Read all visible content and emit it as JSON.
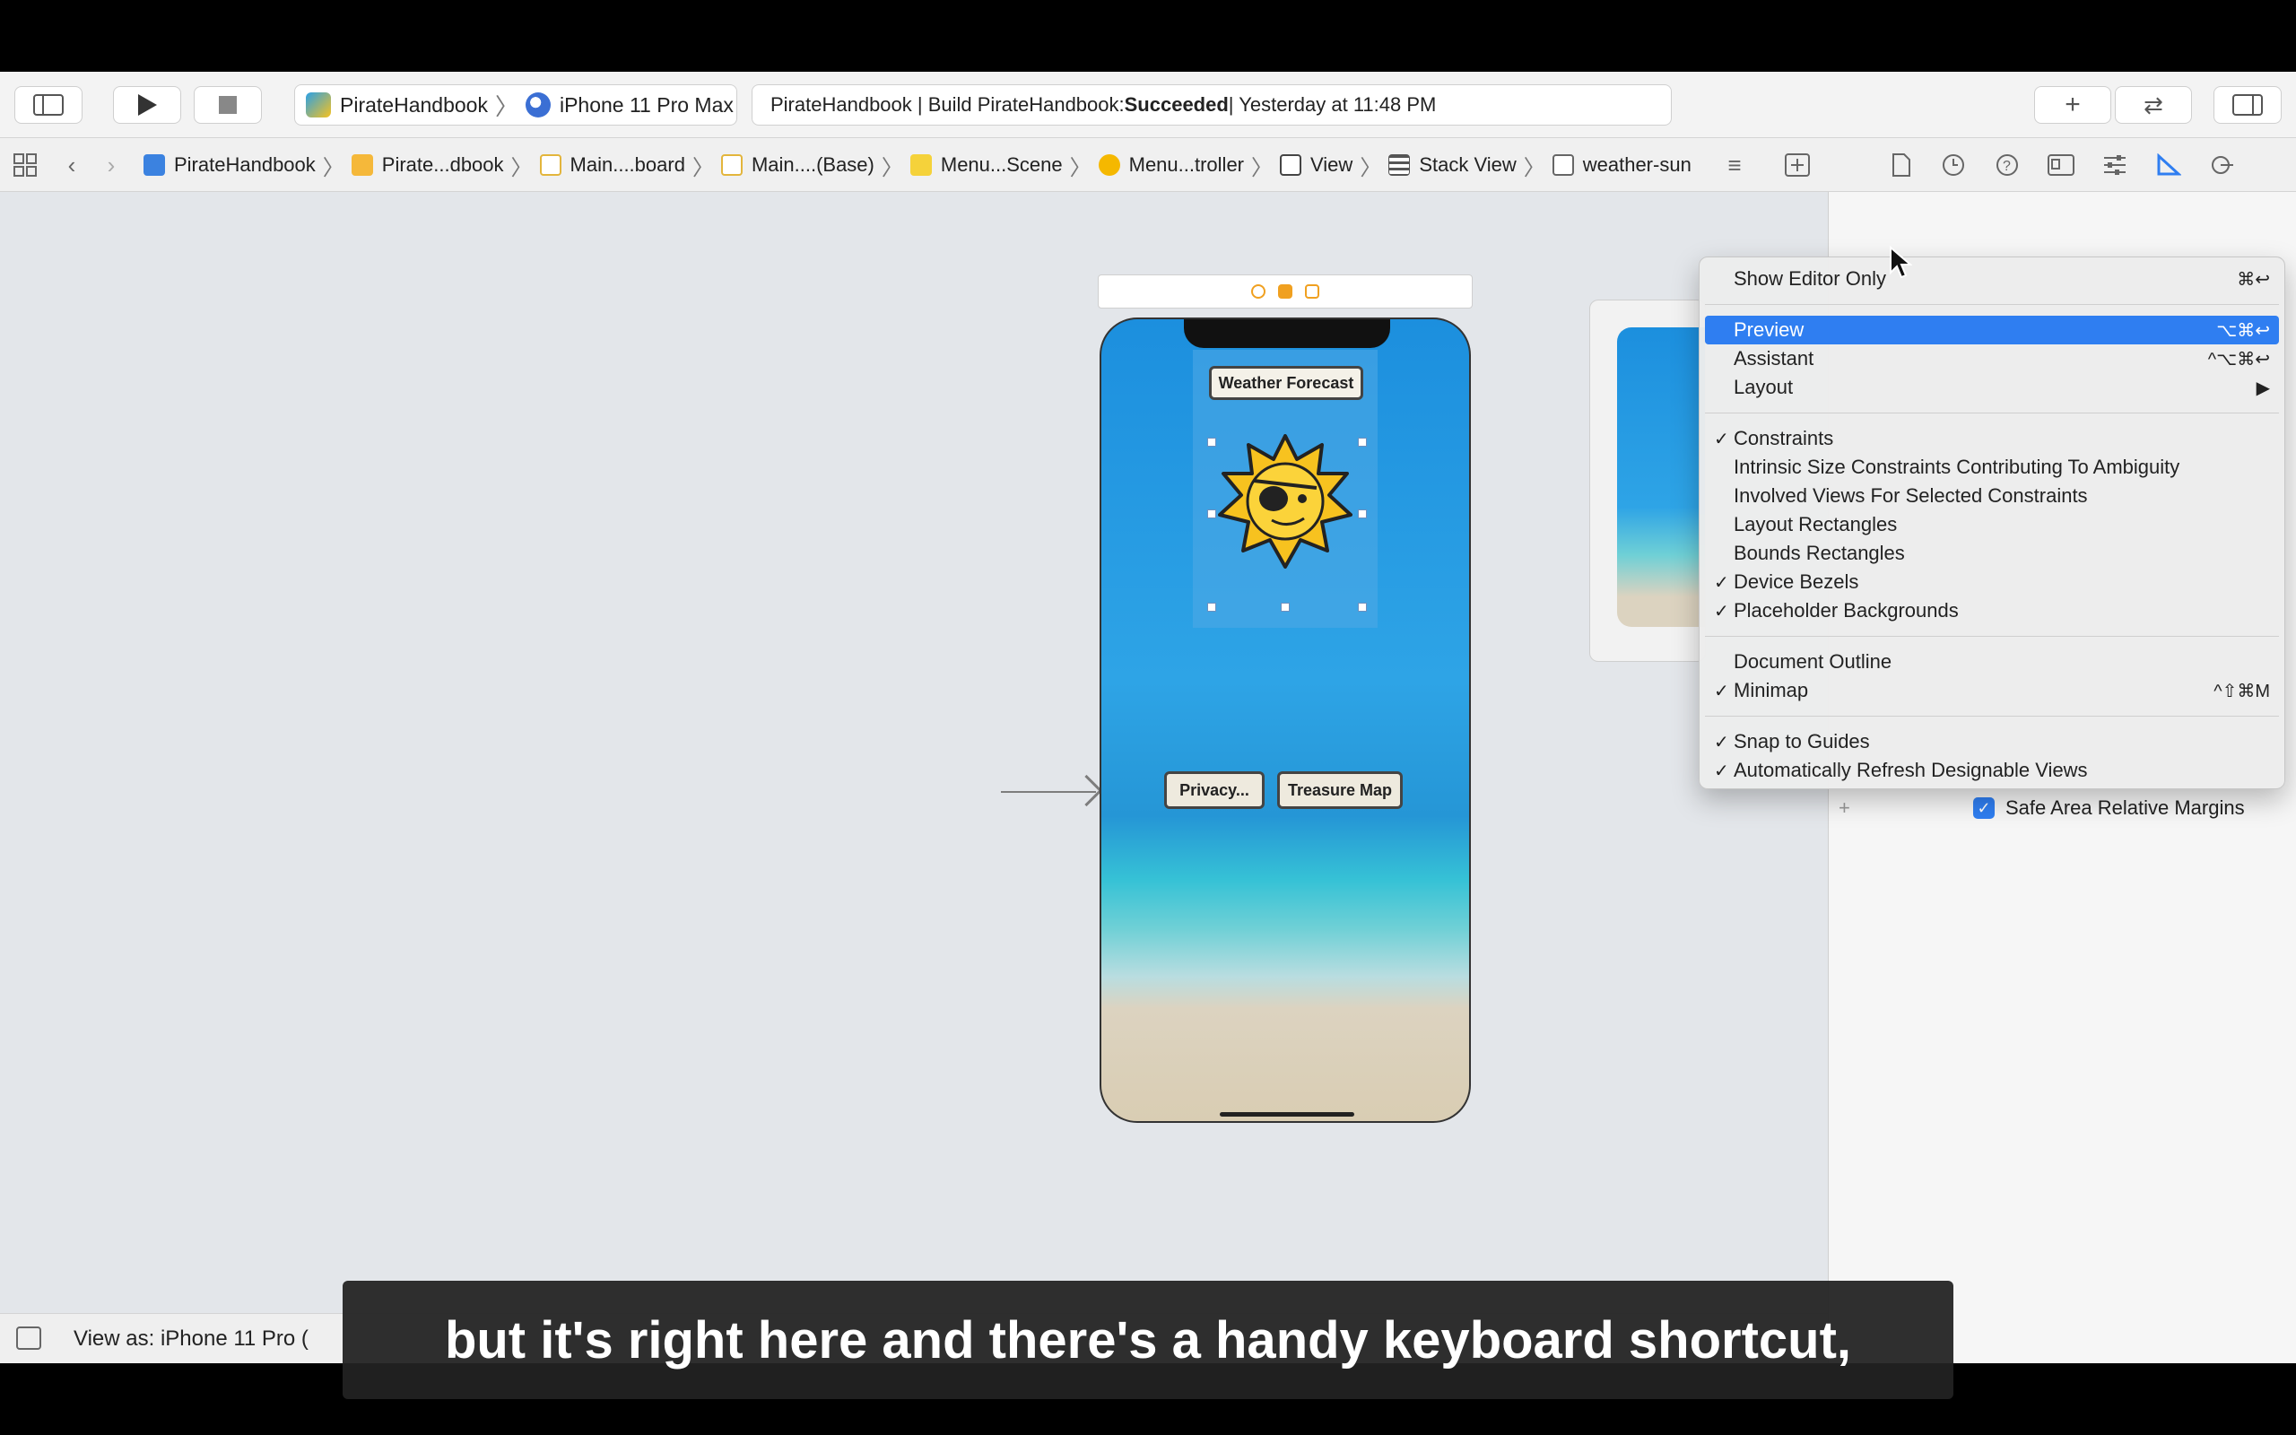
{
  "toolbar": {
    "scheme_app": "PirateHandbook",
    "scheme_device": "iPhone 11 Pro Max",
    "status_prefix": "PirateHandbook | Build PirateHandbook: ",
    "status_result": "Succeeded",
    "status_suffix": " | Yesterday at 11:48 PM"
  },
  "jumpbar": {
    "crumbs": [
      "PirateHandbook",
      "Pirate...dbook",
      "Main....board",
      "Main....(Base)",
      "Menu...Scene",
      "Menu...troller",
      "View",
      "Stack View",
      "weather-sun"
    ]
  },
  "canvas": {
    "weather_label": "Weather Forecast",
    "privacy_button": "Privacy...",
    "treasure_button": "Treasure Map"
  },
  "menu": {
    "items": [
      {
        "label": "Show Editor Only",
        "shortcut": "⌘↩",
        "checked": false
      },
      {
        "label": "Preview",
        "shortcut": "⌥⌘↩",
        "checked": false,
        "highlighted": true
      },
      {
        "label": "Assistant",
        "shortcut": "^⌥⌘↩",
        "checked": false
      },
      {
        "label": "Layout",
        "shortcut": "▶",
        "checked": false
      },
      {
        "label": "Constraints",
        "shortcut": "",
        "checked": true
      },
      {
        "label": "Intrinsic Size Constraints Contributing To Ambiguity",
        "shortcut": "",
        "checked": false
      },
      {
        "label": "Involved Views For Selected Constraints",
        "shortcut": "",
        "checked": false
      },
      {
        "label": "Layout Rectangles",
        "shortcut": "",
        "checked": false
      },
      {
        "label": "Bounds Rectangles",
        "shortcut": "",
        "checked": false
      },
      {
        "label": "Device Bezels",
        "shortcut": "",
        "checked": true
      },
      {
        "label": "Placeholder Backgrounds",
        "shortcut": "",
        "checked": true
      },
      {
        "label": "Document Outline",
        "shortcut": "",
        "checked": false
      },
      {
        "label": "Minimap",
        "shortcut": "^⇧⌘M",
        "checked": true
      },
      {
        "label": "Snap to Guides",
        "shortcut": "",
        "checked": true
      },
      {
        "label": "Automatically Refresh Designable Views",
        "shortcut": "",
        "checked": true
      }
    ]
  },
  "inspector": {
    "safe_area_label": "Safe Area Relative Margins",
    "checkmark": "✓"
  },
  "bottom": {
    "view_as": "View as: iPhone 11 Pro ("
  },
  "caption": "but it's right here and there's a handy keyboard shortcut,",
  "colors": {
    "accent": "#2f7ef1",
    "sky": "#1c8fde",
    "sun": "#f7c21f"
  }
}
